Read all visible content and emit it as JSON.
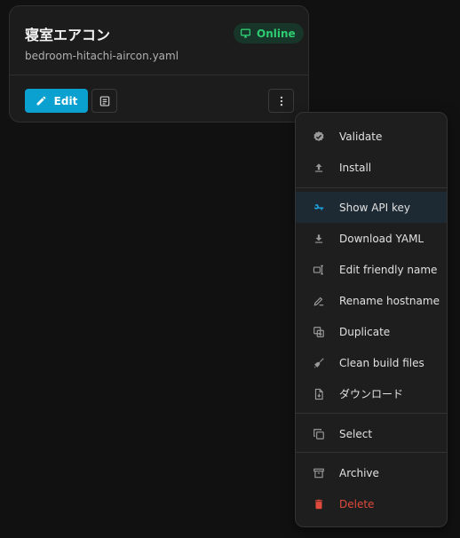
{
  "card": {
    "title": "寝室エアコン",
    "filename": "bedroom-hitachi-aircon.yaml",
    "status": "Online",
    "edit_label": "Edit"
  },
  "menu": {
    "items": [
      {
        "label": "Validate",
        "icon": "check-badge-icon"
      },
      {
        "label": "Install",
        "icon": "upload-icon"
      },
      {
        "label": "Show API key",
        "icon": "key-icon"
      },
      {
        "label": "Download YAML",
        "icon": "download-icon"
      },
      {
        "label": "Edit friendly name",
        "icon": "rename-box-icon"
      },
      {
        "label": "Rename hostname",
        "icon": "pencil-line-icon"
      },
      {
        "label": "Duplicate",
        "icon": "duplicate-icon"
      },
      {
        "label": "Clean build files",
        "icon": "broom-icon"
      },
      {
        "label": "ダウンロード",
        "icon": "file-download-icon"
      },
      {
        "label": "Select",
        "icon": "select-copy-icon"
      },
      {
        "label": "Archive",
        "icon": "archive-icon"
      },
      {
        "label": "Delete",
        "icon": "trash-icon"
      }
    ]
  },
  "colors": {
    "accent": "#0aa0d0",
    "online": "#2ecc71",
    "danger": "#e04a3c",
    "key": "#1ea0dc"
  }
}
